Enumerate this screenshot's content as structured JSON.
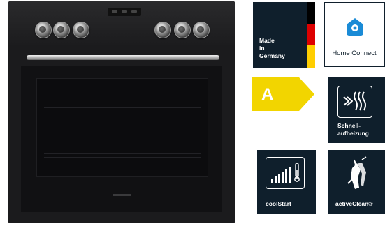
{
  "badges": {
    "made_in_germany": {
      "line1": "Made",
      "line2": "in",
      "line3": "Germany",
      "flag_colors": [
        "#000000",
        "#dd0000",
        "#ffce00"
      ]
    },
    "home_connect": {
      "label": "Home Connect",
      "icon": "home-connect-icon",
      "accent": "#1a8bd6"
    },
    "energy_class": {
      "letter": "A",
      "color": "#f2d500"
    },
    "schnellaufheizung": {
      "line1": "Schnell-",
      "line2": "aufheizung",
      "icon": "fast-preheat-icon"
    },
    "coolstart": {
      "label": "coolStart",
      "icon": "coolstart-icon"
    },
    "activeclean": {
      "label": "activeClean®",
      "icon": "activeclean-icon"
    }
  },
  "colors": {
    "badge_dark": "#0f1f2c",
    "oven_body": "#1b1b1d"
  }
}
